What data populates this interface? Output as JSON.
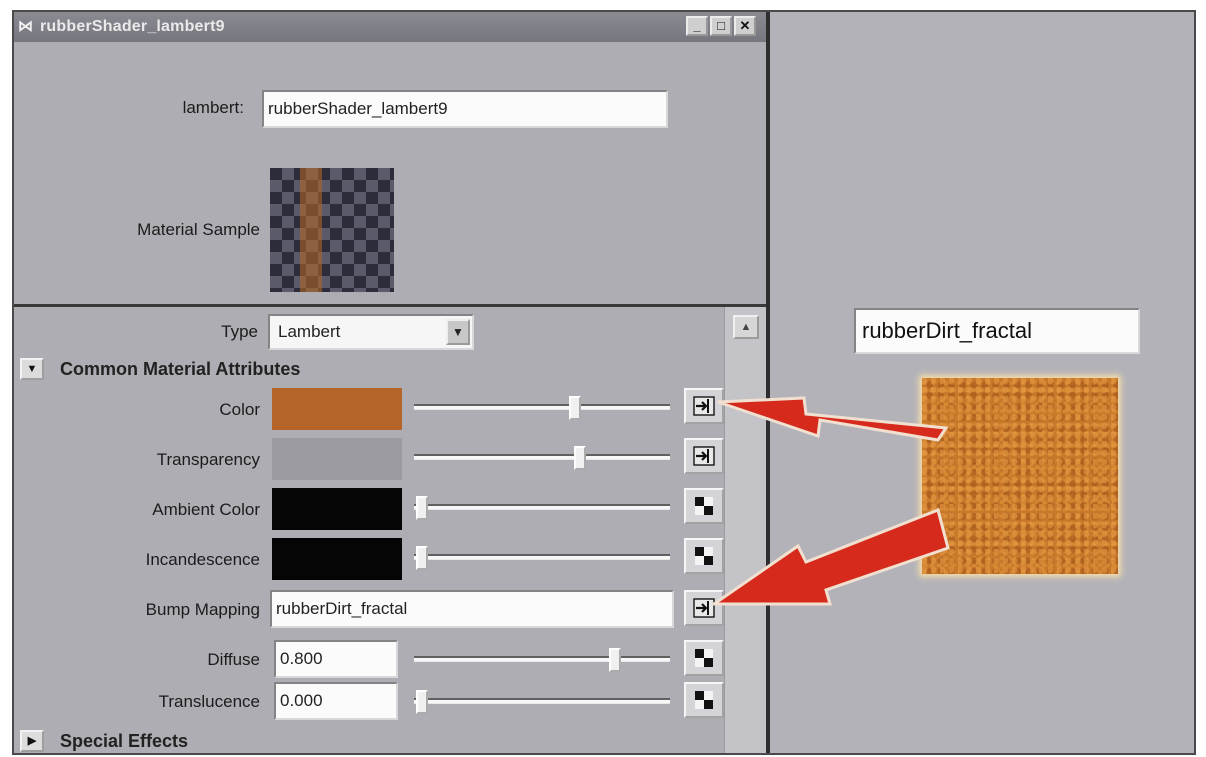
{
  "window": {
    "title": "rubberShader_lambert9",
    "buttons": {
      "minimize": "_",
      "maximize": "□",
      "close": "✕"
    }
  },
  "header": {
    "lambert_label": "lambert:",
    "lambert_value": "rubberShader_lambert9",
    "material_sample_label": "Material Sample"
  },
  "type": {
    "label": "Type",
    "value": "Lambert"
  },
  "sections": {
    "common": {
      "title": "Common Material Attributes",
      "expanded": true
    },
    "special": {
      "title": "Special Effects",
      "expanded": false
    }
  },
  "attributes": {
    "color": {
      "label": "Color",
      "swatch": "#b5652a",
      "slider": 0.63,
      "mapped": true
    },
    "transparency": {
      "label": "Transparency",
      "swatch": "#9a9aa0",
      "slider": 0.65,
      "mapped": true
    },
    "ambient": {
      "label": "Ambient Color",
      "swatch": "#050505",
      "slider": 0.0,
      "mapped": false
    },
    "incandescence": {
      "label": "Incandescence",
      "swatch": "#050505",
      "slider": 0.0,
      "mapped": false
    },
    "bump": {
      "label": "Bump Mapping",
      "value": "rubberDirt_fractal",
      "mapped": true
    },
    "diffuse": {
      "label": "Diffuse",
      "value": "0.800",
      "slider": 0.8,
      "mapped": false
    },
    "translucence": {
      "label": "Translucence",
      "value": "0.000",
      "slider": 0.0,
      "mapped": false
    }
  },
  "texture_panel": {
    "name": "rubberDirt_fractal",
    "color": "#c8782a"
  },
  "colors": {
    "arrow": "#d62a1c",
    "window_bg": "#adadb3",
    "titlebar": "#7e7e86"
  },
  "icons": {
    "app": "maya-icon",
    "map_connected": "map-connected-icon",
    "map_checker": "checker-map-icon",
    "expand": "triangle-down-icon",
    "collapse": "triangle-right-icon"
  }
}
